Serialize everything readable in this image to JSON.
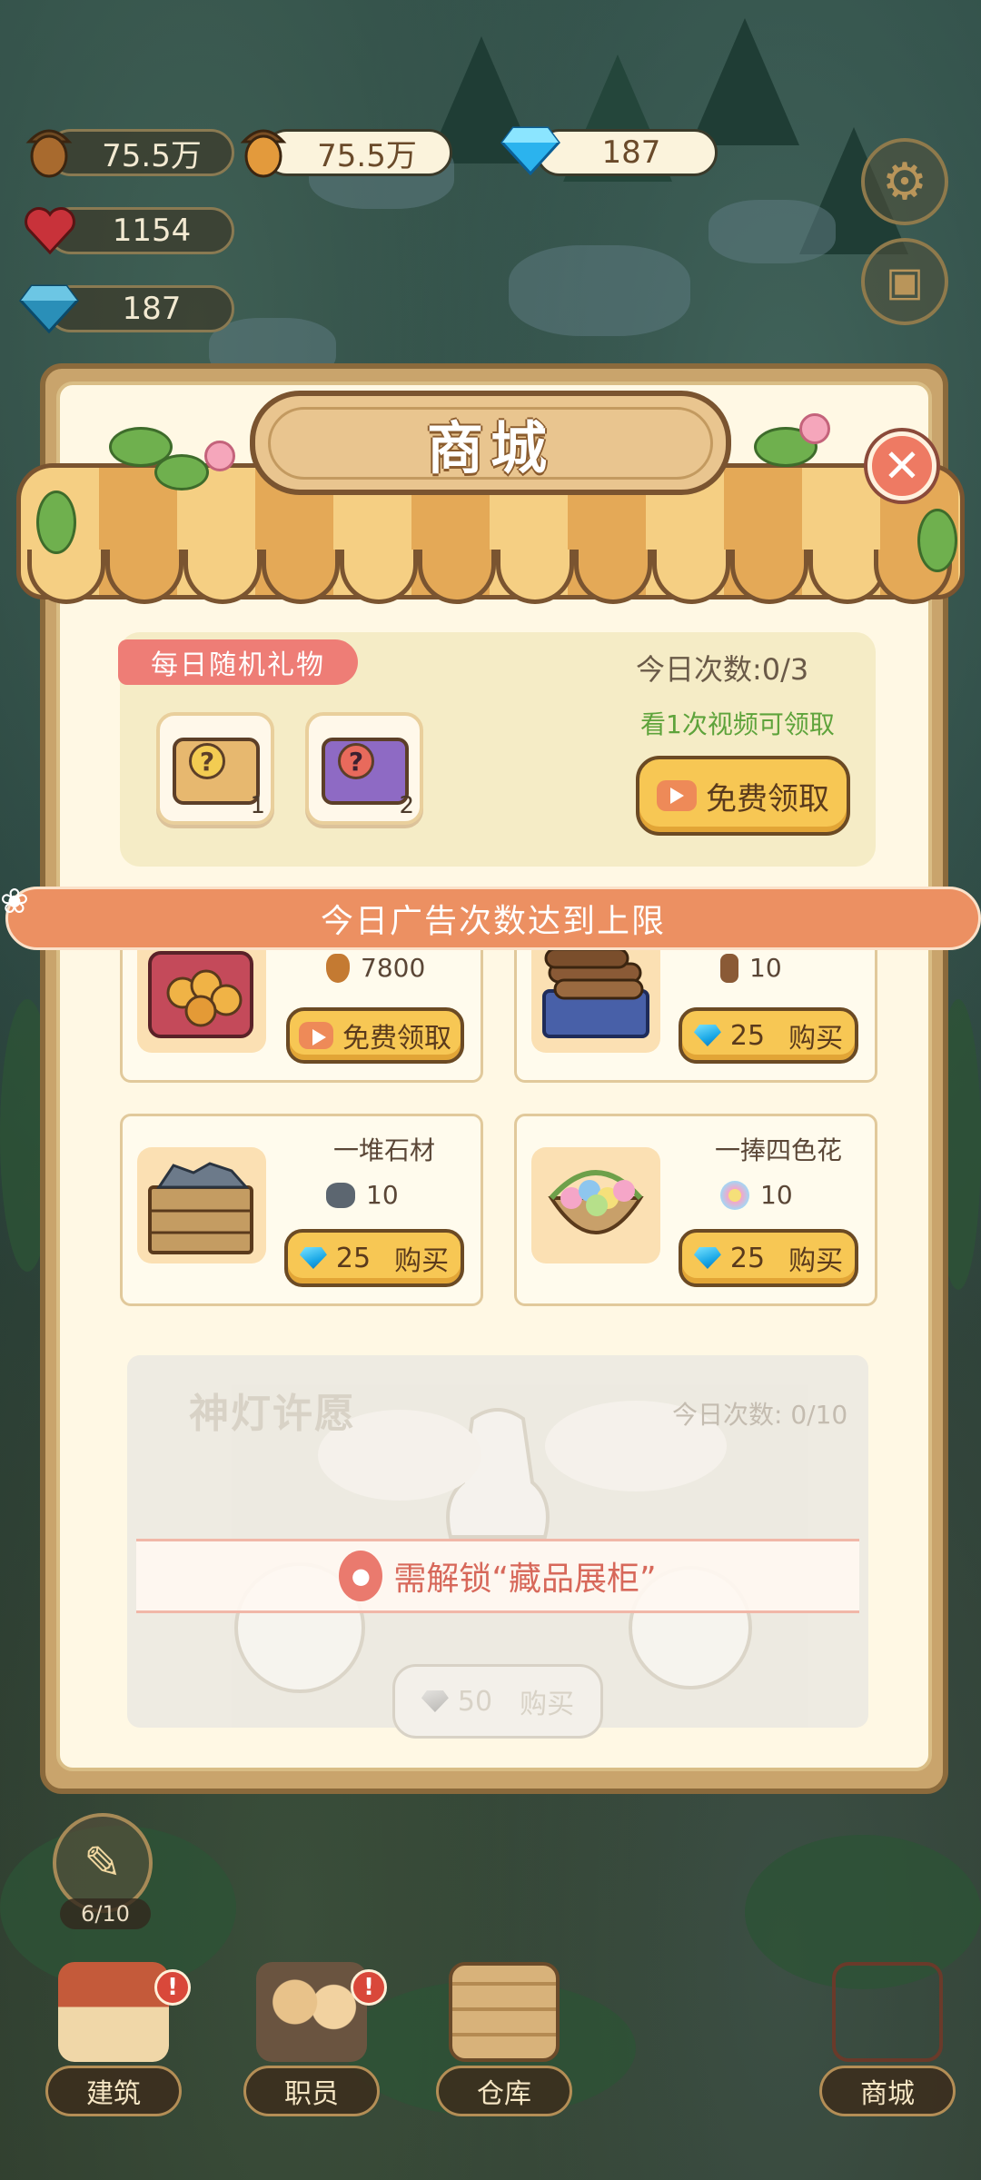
{
  "resources": {
    "acorn_left": "75.5万",
    "acorn_main": "75.5万",
    "gem_main": "187",
    "hearts": "1154",
    "gem_left": "187"
  },
  "shop": {
    "title": "商城",
    "daily": {
      "tag": "每日随机礼物",
      "count_text": "今日次数:0/3",
      "hint": "看1次视频可领取",
      "button": "免费领取",
      "gifts": [
        {
          "count": "1",
          "color": "#e7b86f"
        },
        {
          "count": "2",
          "color": "#8e6ac4"
        }
      ]
    },
    "ad_banner": "今日广告次数达到上限",
    "items": [
      {
        "qty": "7800",
        "button": "免费领取"
      },
      {
        "qty": "10",
        "price": "25",
        "button": "购买"
      },
      {
        "name": "一堆石材",
        "qty": "10",
        "price": "25",
        "button": "购买"
      },
      {
        "name": "一捧四色花",
        "qty": "10",
        "price": "25",
        "button": "购买"
      }
    ],
    "lamp": {
      "title": "神灯许愿",
      "count_text": "今日次数: 0/10",
      "lock_text": "需解锁“藏品展柜”",
      "price": "50",
      "button": "购买"
    }
  },
  "task": {
    "count": "6/10"
  },
  "nav": {
    "build": "建筑",
    "staff": "职员",
    "warehouse": "仓库",
    "shop": "商城",
    "badge": "!"
  },
  "colors": {
    "accent_yellow": "#f7c754",
    "ad_orange": "#ec9062",
    "daily_tag": "#ee7d76",
    "hint_green": "#5ea33b"
  },
  "icons": {
    "acorn": "acorn-icon",
    "gem": "gem-icon",
    "heart": "heart-icon",
    "settings": "gear-icon",
    "book": "book-icon",
    "close": "close-icon",
    "video": "video-icon",
    "lock": "lock-icon"
  }
}
